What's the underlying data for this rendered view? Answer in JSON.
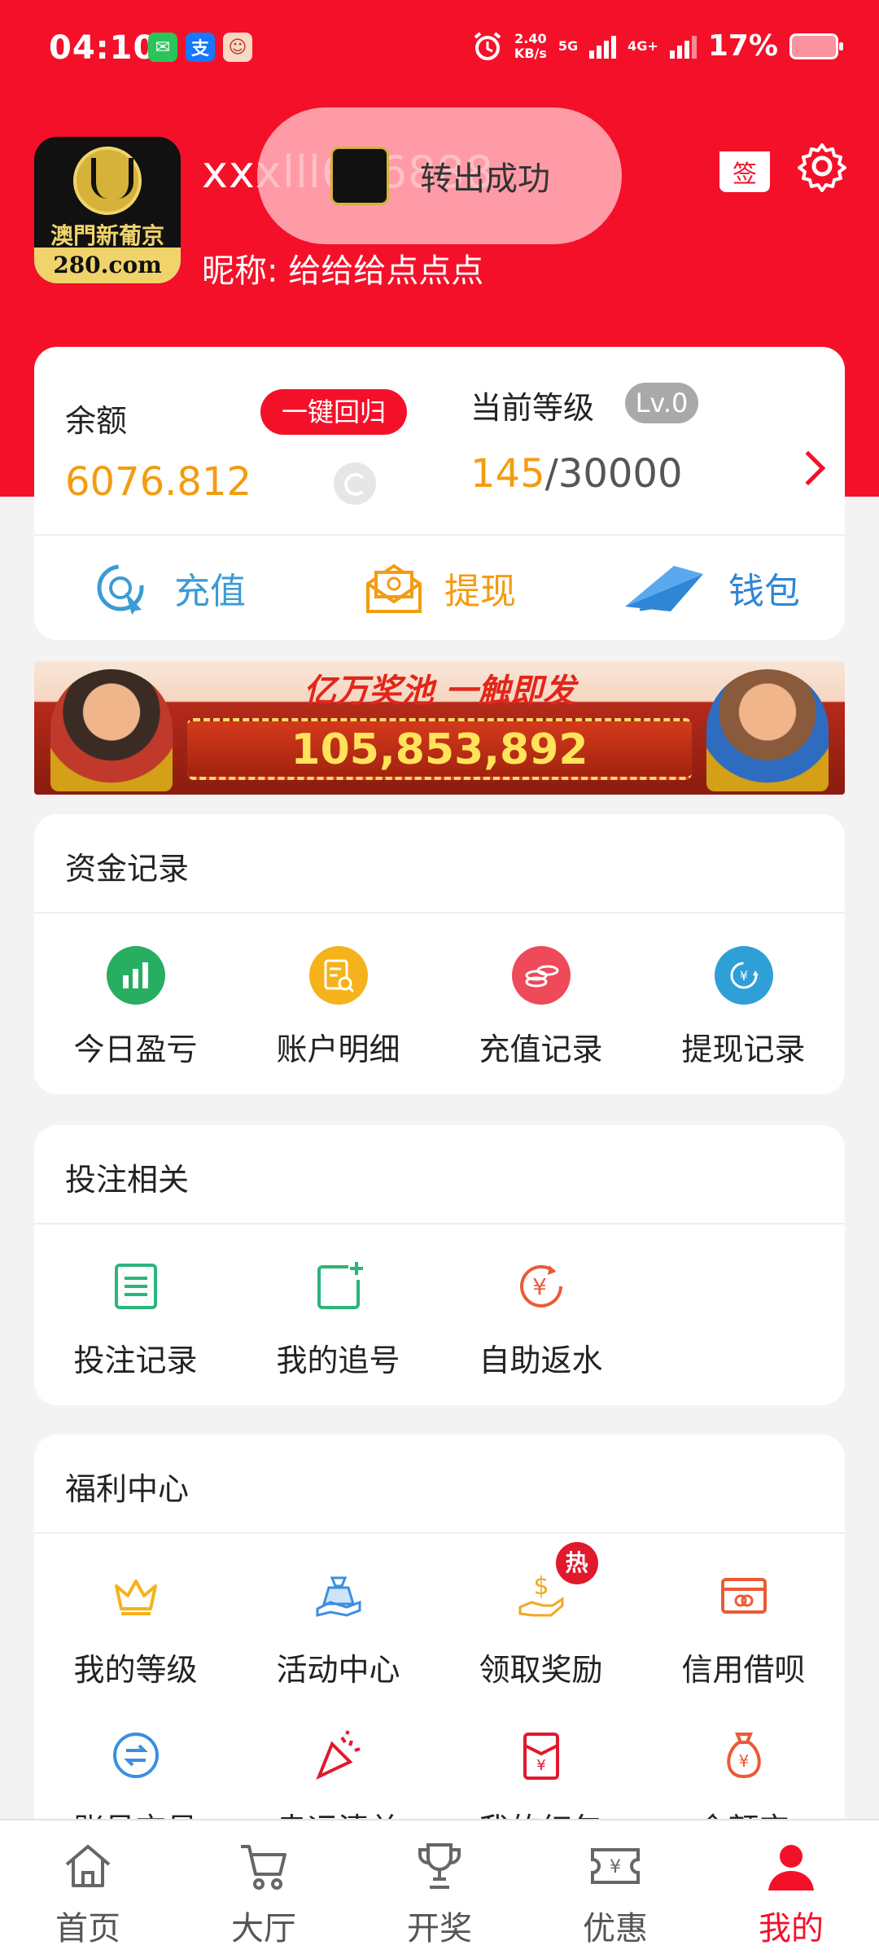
{
  "status_bar": {
    "time": "04:10",
    "speed_value": "2.40",
    "speed_unit": "KB/s",
    "net1": "5G",
    "net2": "4G+",
    "battery": "17%",
    "apps": [
      "wechat-icon",
      "alipay-icon",
      "app-icon"
    ]
  },
  "profile": {
    "username": "xxxlll666888",
    "nickname": "昵称: 给给给点点点",
    "avatar_text_top": "澳門新葡京",
    "avatar_text_bottom": "280.com",
    "sign_label": "签"
  },
  "toast": {
    "text": "转出成功"
  },
  "balance": {
    "label": "余额",
    "return_button": "一键回归",
    "amount": "6076.812",
    "level_label": "当前等级",
    "level_badge": "Lv.0",
    "level_current": "145",
    "level_total": "/30000",
    "actions": [
      {
        "label": "充值",
        "icon": "deposit-icon",
        "color": "#3a9bd5"
      },
      {
        "label": "提现",
        "icon": "withdraw-icon",
        "color": "#f39c12"
      },
      {
        "label": "钱包",
        "icon": "wallet-icon",
        "color": "#2f86d6"
      }
    ]
  },
  "banner": {
    "tagline": "亿万奖池 一触即发",
    "jackpot": "105,853,892"
  },
  "funds": {
    "title": "资金记录",
    "items": [
      {
        "label": "今日盈亏",
        "icon": "chart-icon",
        "color": "#27ae60"
      },
      {
        "label": "账户明细",
        "icon": "account-detail-icon",
        "color": "#f5b21b"
      },
      {
        "label": "充值记录",
        "icon": "coins-icon",
        "color": "#ee4a5a"
      },
      {
        "label": "提现记录",
        "icon": "exchange-icon",
        "color": "#2f9fd8"
      }
    ]
  },
  "betting": {
    "title": "投注相关",
    "items": [
      {
        "label": "投注记录",
        "icon": "list-icon",
        "color": "#2bb57a"
      },
      {
        "label": "我的追号",
        "icon": "add-note-icon",
        "color": "#2bb57a"
      },
      {
        "label": "自助返水",
        "icon": "rebate-icon",
        "color": "#ec5a36"
      }
    ]
  },
  "welfare": {
    "title": "福利中心",
    "hot_label": "热",
    "items": [
      {
        "label": "我的等级",
        "icon": "crown-icon",
        "color": "#f5b21b"
      },
      {
        "label": "活动中心",
        "icon": "gift-icon",
        "color": "#3a8fe0"
      },
      {
        "label": "领取奖励",
        "icon": "reward-icon",
        "color": "#f5a623"
      },
      {
        "label": "信用借呗",
        "icon": "card-icon",
        "color": "#ec5a36"
      },
      {
        "label": "账号交易",
        "icon": "swap-icon",
        "color": "#3a8fe0"
      },
      {
        "label": "幸运清单",
        "icon": "party-icon",
        "color": "#e0192d"
      },
      {
        "label": "我的红包",
        "icon": "red-envelope-icon",
        "color": "#e0192d"
      },
      {
        "label": "余额宝",
        "icon": "money-bag-icon",
        "color": "#ec5a36"
      }
    ]
  },
  "tabbar": {
    "items": [
      {
        "label": "首页",
        "icon": "home-icon"
      },
      {
        "label": "大厅",
        "icon": "cart-icon"
      },
      {
        "label": "开奖",
        "icon": "trophy-icon"
      },
      {
        "label": "优惠",
        "icon": "coupon-icon"
      },
      {
        "label": "我的",
        "icon": "user-icon",
        "active": true
      }
    ],
    "active_color": "#f5102a"
  }
}
